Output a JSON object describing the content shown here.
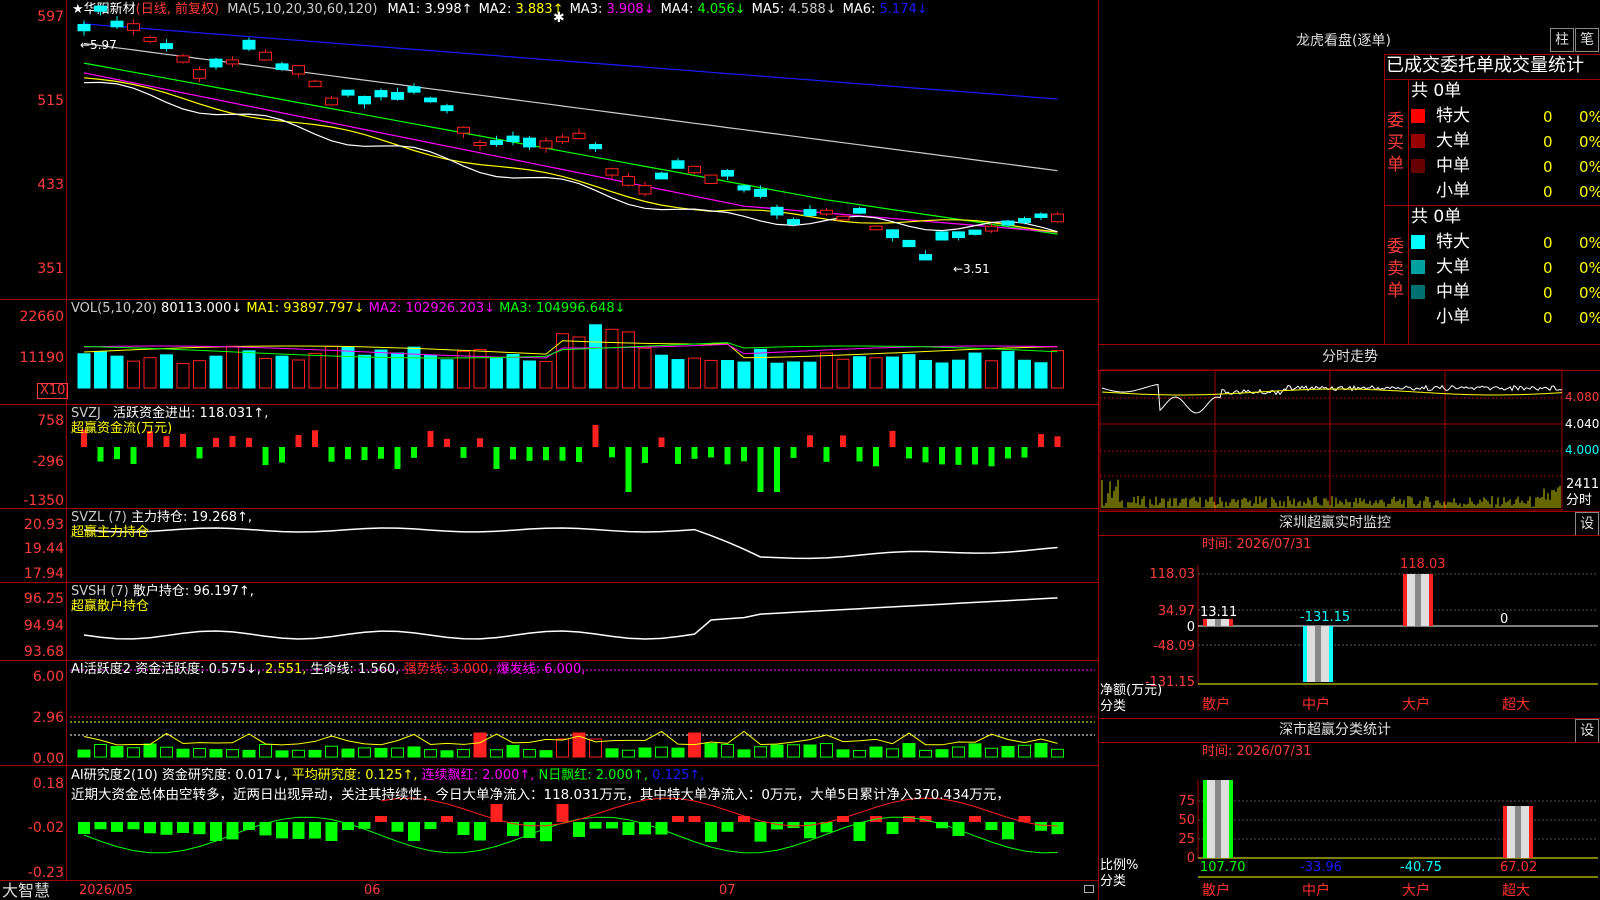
{
  "stock": {
    "name": "华阳新材",
    "period": "(日线, 前复权)",
    "star": "★"
  },
  "colors": {
    "up": "#ff2020",
    "down": "#00ffff",
    "axis": "#ff3c3c",
    "grid": "#a00000",
    "ma1": "#ffffff",
    "ma2": "#ffff00",
    "ma3": "#ff00ff",
    "ma4": "#00ff00",
    "ma5": "#cccccc",
    "ma6": "#1a1aff"
  },
  "main_panel": {
    "ma_label": "MA(5,10,20,30,60,120)",
    "ma": [
      {
        "name": "MA1:",
        "value": "3.998↑",
        "color": "#ffffff"
      },
      {
        "name": "MA2:",
        "value": "3.883↑",
        "color": "#ffff00"
      },
      {
        "name": "MA3:",
        "value": "3.908↓",
        "color": "#ff00ff"
      },
      {
        "name": "MA4:",
        "value": "4.056↓",
        "color": "#00ff00"
      },
      {
        "name": "MA5:",
        "value": "4.588↓",
        "color": "#cccccc"
      },
      {
        "name": "MA6:",
        "value": "5.174↓",
        "color": "#1a1aff"
      }
    ],
    "yticks": [
      "597",
      "515",
      "433",
      "351"
    ],
    "high_label": "←5.97",
    "low_label": "←3.51"
  },
  "vol_panel": {
    "title": "VOL(5,10,20)",
    "value": "80113.000↓",
    "ma1": "MA1: 93897.797↓",
    "ma2": "MA2: 102926.203↓",
    "ma3": "MA3: 104996.648↓",
    "yticks": [
      "22660",
      "11190"
    ],
    "unit": "X10"
  },
  "svzj_panel": {
    "title": "SVZJ",
    "text": "活跃资金进出: 118.031↑,",
    "sub": "超赢资金流(万元)",
    "yticks": [
      "758",
      "-296",
      "-1350"
    ]
  },
  "svzl_panel": {
    "title": "SVZL (7)",
    "text": "主力持仓: 19.268↑,",
    "sub": "超赢主力持仓",
    "yticks": [
      "20.93",
      "19.44",
      "17.94"
    ]
  },
  "svsh_panel": {
    "title": "SVSH (7)",
    "text": "散户持仓: 96.197↑,",
    "sub": "超赢散户持仓",
    "yticks": [
      "96.25",
      "94.94",
      "93.68"
    ]
  },
  "ai_hy_panel": {
    "title": "AI活跃度2",
    "t1": "资金活跃度: 0.575↓,",
    "t2": "2.551,",
    "t3": "生命线: 1.560,",
    "t4": "强势线: 3.000,",
    "t5": "爆发线: 6.000,",
    "yticks": [
      "6.00",
      "2.96",
      "0.00"
    ]
  },
  "ai_yj_panel": {
    "title": "AI研究度2(10)",
    "t1": "资金研究度: 0.017↓,",
    "t2": "平均研究度: 0.125↑,",
    "t3": "连续飘红: 2.000↑,",
    "t4": "N日飘红: 2.000↑,",
    "t5": "0.125↑,",
    "comment": "近期大资金总体由空转多，近两日出现异动，关注其持续性，今日大单净流入：118.031万元，其中特大单净流入：0万元，大单5日累计净入370.434万元，",
    "yticks": [
      "0.18",
      "-0.02",
      "-0.23"
    ]
  },
  "bottom_bar": {
    "brand": "大智慧",
    "dates": [
      "2026/05",
      "06",
      "07"
    ]
  },
  "right": {
    "lhb_title": "龙虎看盘(逐单)",
    "btn1": "柱",
    "btn2": "笔",
    "tabs": [
      "已成交",
      "委托单",
      "成交量统计"
    ],
    "buy_label": "委买单",
    "sell_label": "委卖单",
    "buy_total": "共 0单",
    "sell_total": "共 0单",
    "buy_rows": [
      {
        "name": "特大",
        "count": "0",
        "pct": "0%",
        "color": "#ff0000"
      },
      {
        "name": "大单",
        "count": "0",
        "pct": "0%",
        "color": "#990000"
      },
      {
        "name": "中单",
        "count": "0",
        "pct": "0%",
        "color": "#660000"
      },
      {
        "name": "小单",
        "count": "0",
        "pct": "0%",
        "color": "#000000"
      }
    ],
    "sell_rows": [
      {
        "name": "特大",
        "count": "0",
        "pct": "0%",
        "color": "#00ffff"
      },
      {
        "name": "大单",
        "count": "0",
        "pct": "0%",
        "color": "#00a0a0"
      },
      {
        "name": "中单",
        "count": "0",
        "pct": "0%",
        "color": "#007070"
      },
      {
        "name": "小单",
        "count": "0",
        "pct": "0%",
        "color": "#000000"
      }
    ],
    "fenshi_title": "分时走势",
    "fenshi_yticks": [
      "4.080",
      "4.040",
      "4.000"
    ],
    "fenshi_vol": "2411",
    "fenshi_vol_unit": "分时",
    "sz_monitor": {
      "title": "深圳超赢实时监控",
      "btn": "设",
      "time": "时间: 2026/07/31",
      "yticks": [
        "118.03",
        "34.97",
        "0",
        "-48.09",
        "-131.15"
      ],
      "ylabel1": "净额(万元)",
      "ylabel2": "分类",
      "cats": [
        "散户",
        "中户",
        "大户",
        "超大"
      ],
      "values": [
        "13.11",
        "-131.15",
        "118.03",
        "0"
      ]
    },
    "sz_class": {
      "title": "深市超赢分类统计",
      "btn": "设",
      "time": "时间: 2026/07/31",
      "yticks": [
        "75",
        "50",
        "25",
        "0"
      ],
      "ylabel1": "比例%",
      "ylabel2": "分类",
      "cats": [
        "散户",
        "中户",
        "大户",
        "超大"
      ],
      "values": [
        "107.70",
        "-33.96",
        "-40.75",
        "67.02"
      ]
    }
  }
}
